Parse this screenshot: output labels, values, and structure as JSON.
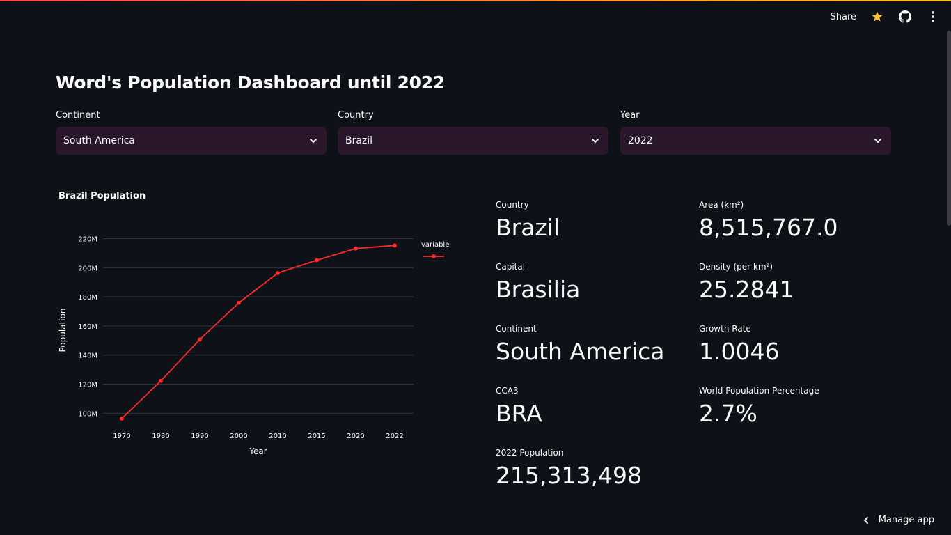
{
  "toolbar": {
    "share": "Share"
  },
  "title": "Word's Population Dashboard until 2022",
  "filters": {
    "continent": {
      "label": "Continent",
      "value": "South America"
    },
    "country": {
      "label": "Country",
      "value": "Brazil"
    },
    "year": {
      "label": "Year",
      "value": "2022"
    }
  },
  "chart_title": "Brazil Population",
  "metrics": {
    "country": {
      "label": "Country",
      "value": "Brazil"
    },
    "area": {
      "label": "Area (km²)",
      "value": "8,515,767.0"
    },
    "capital": {
      "label": "Capital",
      "value": "Brasilia"
    },
    "density": {
      "label": "Density (per km²)",
      "value": "25.2841"
    },
    "continent": {
      "label": "Continent",
      "value": "South America"
    },
    "growth": {
      "label": "Growth Rate",
      "value": "1.0046"
    },
    "cca3": {
      "label": "CCA3",
      "value": "BRA"
    },
    "world_pct": {
      "label": "World Population Percentage",
      "value": "2.7%"
    },
    "population": {
      "label": "2022 Population",
      "value": "215,313,498"
    }
  },
  "manage_app": "Manage app",
  "colors": {
    "accent": "#ff2b2b",
    "select_bg": "#2b172c",
    "background": "#0e1117",
    "star": "#fdbf2c"
  },
  "icons": [
    "star-icon",
    "github-icon",
    "kebab-menu-icon",
    "chevron-down-icon",
    "chevron-left-icon"
  ],
  "chart_data": {
    "type": "line",
    "title": "Brazil Population",
    "xlabel": "Year",
    "ylabel": "Population",
    "legend_title": "variable",
    "legend_position": "top-right",
    "x": [
      "1970",
      "1980",
      "1990",
      "2000",
      "2010",
      "2015",
      "2020",
      "2022"
    ],
    "series": [
      {
        "values": [
          96369875,
          122288383,
          150706446,
          175873720,
          196353492,
          205188205,
          213196304,
          215313498
        ]
      }
    ],
    "yticks": [
      100000000,
      120000000,
      140000000,
      160000000,
      180000000,
      200000000,
      220000000
    ],
    "ytick_labels": [
      "100M",
      "120M",
      "140M",
      "160M",
      "180M",
      "200M",
      "220M"
    ],
    "ylim": [
      92000000,
      226000000
    ],
    "grid": true,
    "color": "#ff2b2b"
  }
}
